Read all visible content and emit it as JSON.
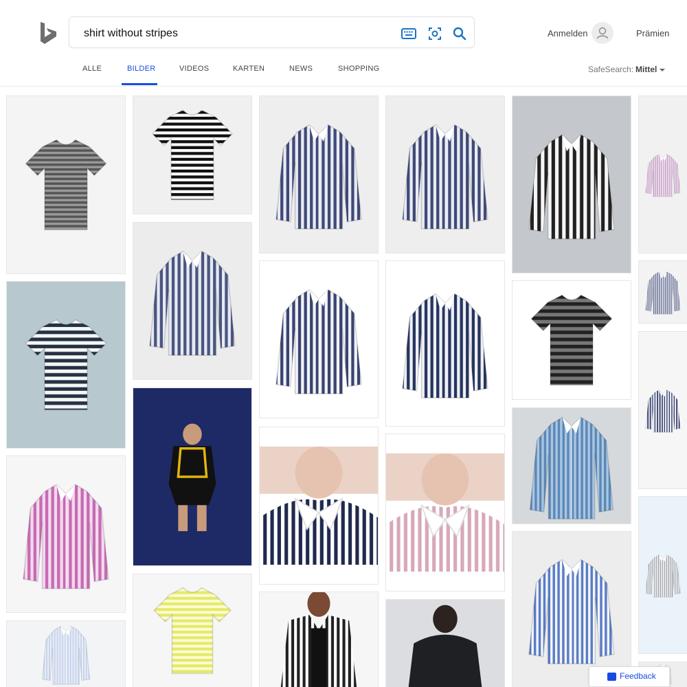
{
  "header": {
    "search_value": "shirt without stripes",
    "icons": [
      "keyboard-icon",
      "visual-search-icon",
      "search-icon"
    ],
    "signin_label": "Anmelden",
    "rewards_label": "Prämien"
  },
  "tabs": [
    {
      "label": "ALLE",
      "active": false
    },
    {
      "label": "BILDER",
      "active": true
    },
    {
      "label": "VIDEOS",
      "active": false
    },
    {
      "label": "KARTEN",
      "active": false
    },
    {
      "label": "NEWS",
      "active": false
    },
    {
      "label": "SHOPPING",
      "active": false
    }
  ],
  "safesearch": {
    "label": "SafeSearch:",
    "value": "Mittel"
  },
  "colors": {
    "accent": "#174ae4",
    "text": "#444444"
  },
  "feedback_label": "Feedback"
}
